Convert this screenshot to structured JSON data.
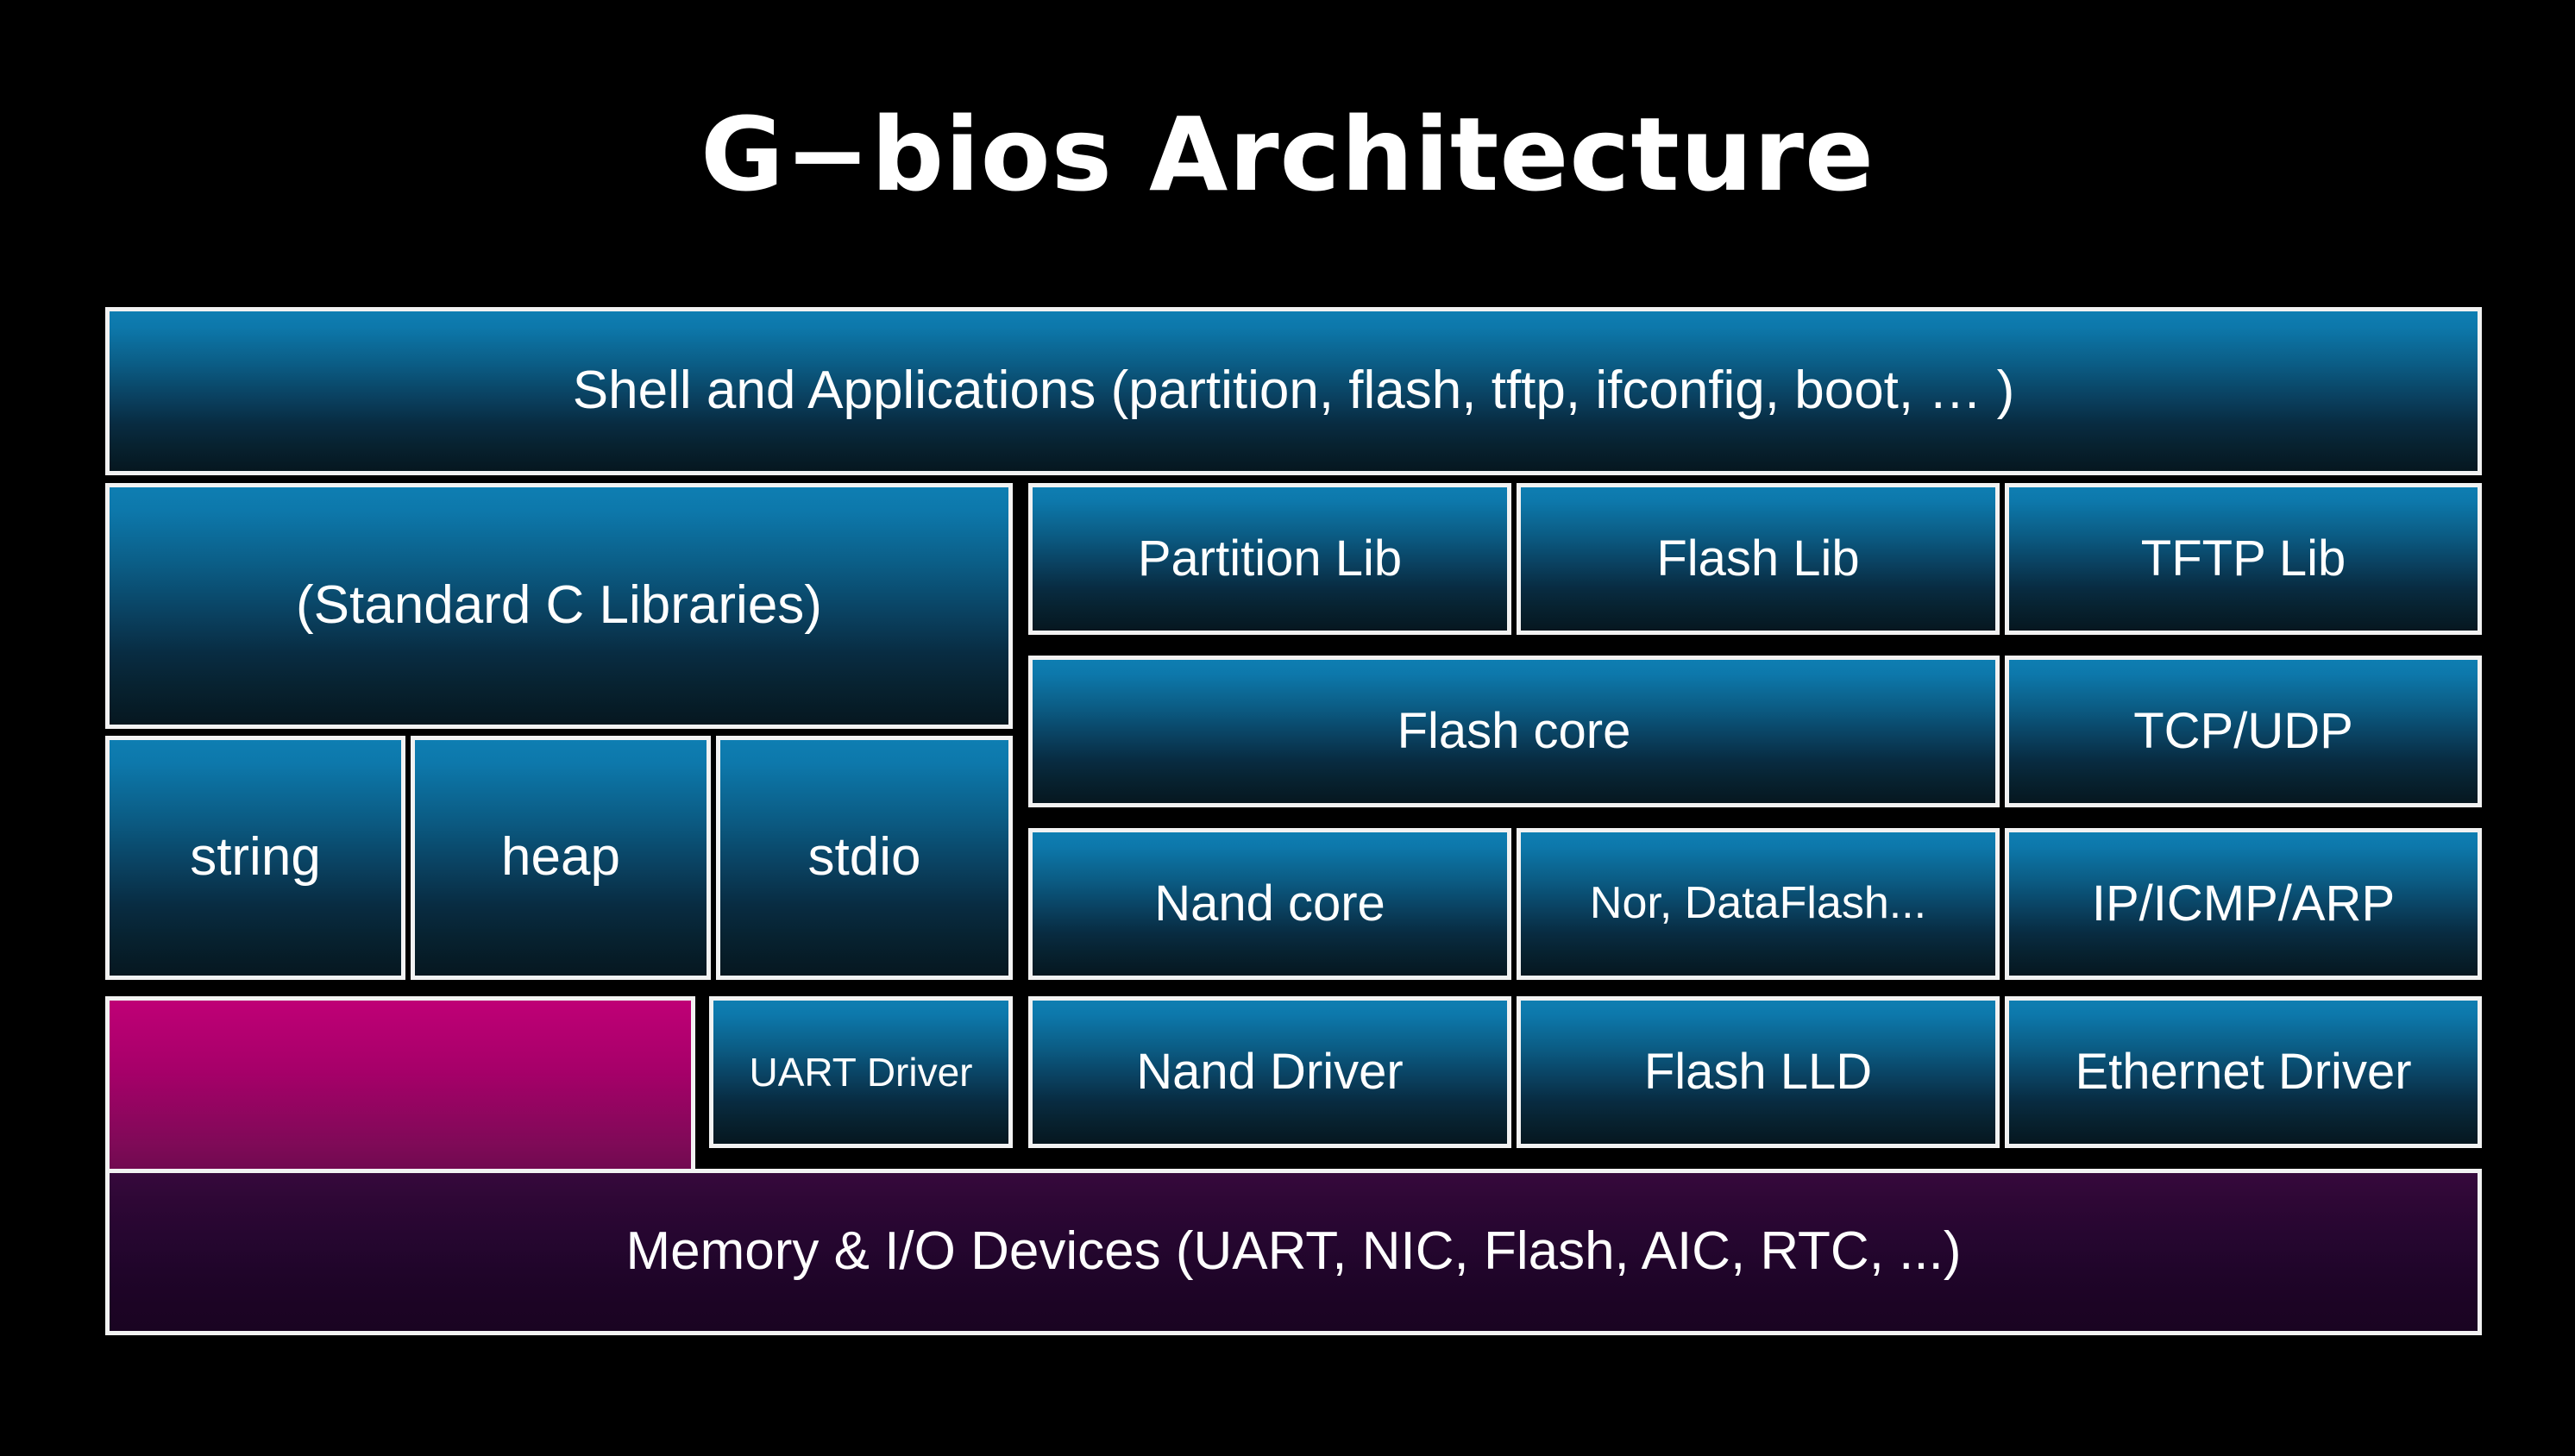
{
  "slide": {
    "title": "G−bios Architecture",
    "background_color": "#000000",
    "border_color": "#f2f2f2",
    "blue_accent": "#0e7eb2",
    "magenta_accent": "#bf0076",
    "purple_accent": "#36093c"
  },
  "layers": {
    "application": {
      "label": "Shell and Applications (partition, flash, tftp, ifconfig, boot, … )"
    },
    "library_left": {
      "label": "(Standard C Libraries)"
    },
    "library_right": [
      {
        "label": "Partition Lib"
      },
      {
        "label": "Flash Lib"
      },
      {
        "label": "TFTP Lib"
      }
    ],
    "core_row": [
      {
        "label": "Flash core"
      },
      {
        "label": "TCP/UDP"
      }
    ],
    "clib_modules": [
      {
        "label": "string"
      },
      {
        "label": "heap"
      },
      {
        "label": "stdio"
      }
    ],
    "subcore_row": [
      {
        "label": "Nand core"
      },
      {
        "label": "Nor, DataFlash..."
      },
      {
        "label": "IP/ICMP/ARP"
      }
    ],
    "driver_row": [
      {
        "label": ""
      },
      {
        "label": "UART Driver"
      },
      {
        "label": "Nand Driver"
      },
      {
        "label": "Flash LLD"
      },
      {
        "label": "Ethernet Driver"
      }
    ],
    "hardware": {
      "label": "Memory  &  I/O Devices  (UART, NIC, Flash, AIC, RTC, ...)"
    }
  }
}
